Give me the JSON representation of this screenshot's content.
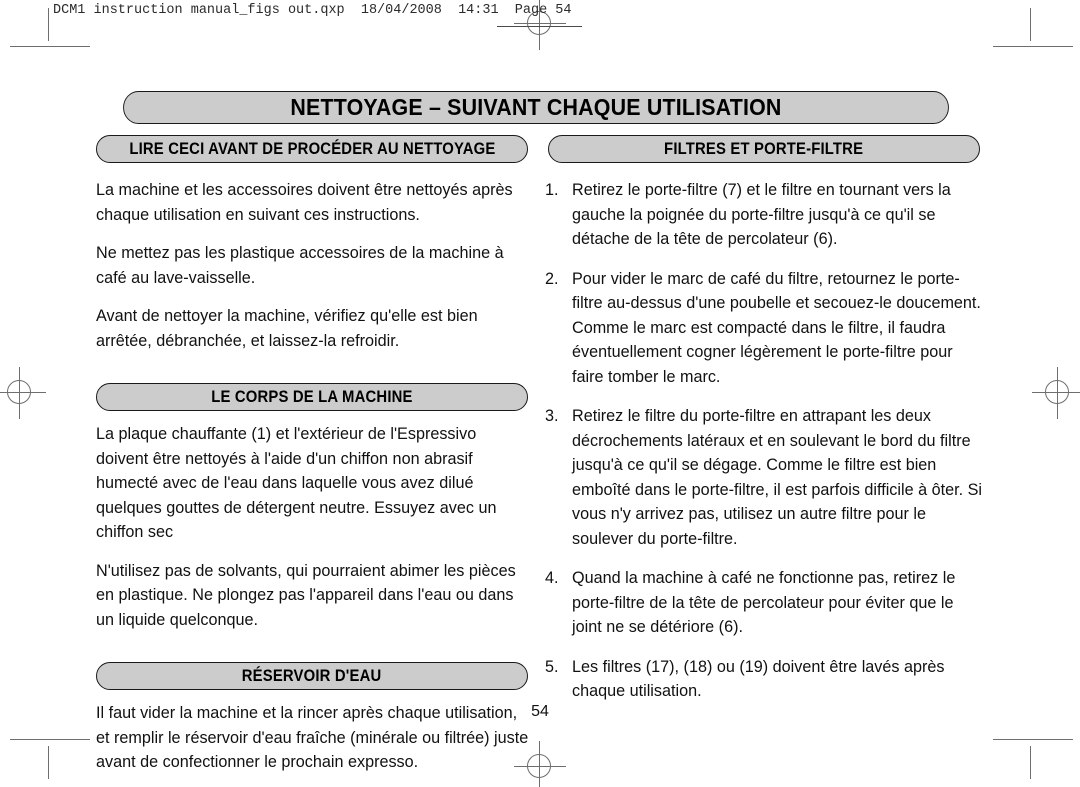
{
  "document": {
    "slug_line": "DCM1 instruction manual_figs out.qxp  18/04/2008  14:31  Page 54",
    "page_number": "54",
    "colors": {
      "banner_fill": "#cccccc",
      "banner_border": "#1a1a1a",
      "text": "#111111",
      "mark": "#6e6e6e"
    }
  },
  "main_title": "NETTOYAGE – SUIVANT CHAQUE UTILISATION",
  "left_column": {
    "heading_1": "LIRE CECI AVANT DE PROCÉDER AU NETTOYAGE",
    "paragraphs_1": [
      "La machine et les accessoires doivent être nettoyés après chaque utilisation en suivant ces instructions.",
      "Ne mettez pas les plastique accessoires de la machine à café au lave-vaisselle.",
      "Avant de nettoyer la machine, vérifiez qu'elle est bien arrêtée, débranchée, et laissez-la refroidir."
    ],
    "heading_2": "LE CORPS DE LA MACHINE",
    "paragraphs_2": [
      "La plaque chauffante (1) et l'extérieur de l'Espressivo doivent être nettoyés à l'aide d'un chiffon non abrasif humecté avec de l'eau dans laquelle vous avez dilué quelques gouttes de détergent neutre. Essuyez avec un chiffon sec",
      "N'utilisez pas de solvants, qui pourraient abimer les pièces en plastique. Ne plongez pas l'appareil dans l'eau ou dans un liquide quelconque."
    ],
    "heading_3": "RÉSERVOIR D'EAU",
    "paragraphs_3": [
      "Il faut vider la machine et la rincer après chaque utilisation, et remplir le réservoir d'eau fraîche (minérale ou filtrée) juste avant de confectionner le prochain expresso."
    ]
  },
  "right_column": {
    "heading": "FILTRES ET PORTE-FILTRE",
    "items": [
      {
        "number": "1.",
        "text": "Retirez le porte-filtre (7) et le filtre en tournant vers la gauche la poignée du porte-filtre jusqu'à ce qu'il se détache de la tête de percolateur (6)."
      },
      {
        "number": "2.",
        "text": "Pour vider le marc de café du filtre, retournez le porte-filtre au-dessus d'une poubelle et secouez-le doucement. Comme le marc est compacté dans le filtre, il faudra éventuellement cogner légèrement le porte-filtre pour faire tomber le marc."
      },
      {
        "number": "3.",
        "text": "Retirez le filtre du porte-filtre en attrapant les deux décrochements latéraux et en soulevant le bord du filtre jusqu'à ce qu'il se dégage. Comme le filtre est bien emboîté dans le porte-filtre, il est parfois difficile à ôter. Si vous n'y arrivez pas, utilisez un autre filtre pour le soulever du porte-filtre."
      },
      {
        "number": "4.",
        "text": "Quand la machine à café ne fonctionne pas, retirez le porte-filtre de la tête de percolateur pour éviter que le joint ne se détériore (6)."
      },
      {
        "number": "5.",
        "text": "Les filtres (17), (18) ou (19) doivent être lavés après chaque utilisation."
      }
    ]
  }
}
